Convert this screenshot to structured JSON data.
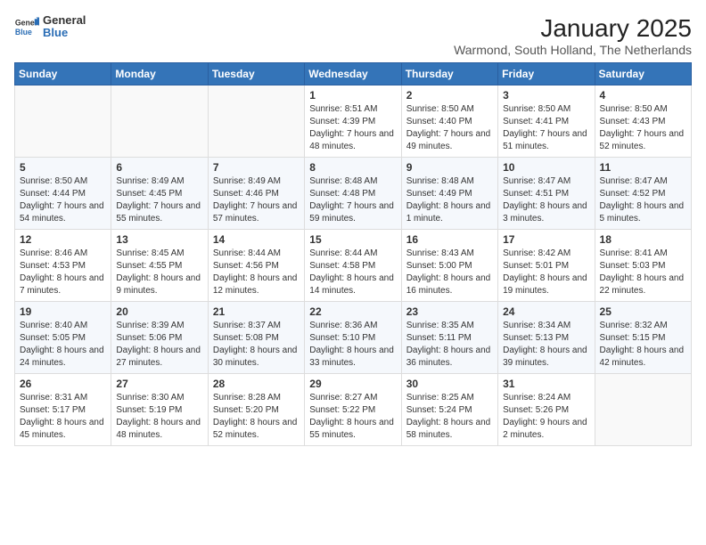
{
  "header": {
    "logo_general": "General",
    "logo_blue": "Blue",
    "title": "January 2025",
    "subtitle": "Warmond, South Holland, The Netherlands"
  },
  "weekdays": [
    "Sunday",
    "Monday",
    "Tuesday",
    "Wednesday",
    "Thursday",
    "Friday",
    "Saturday"
  ],
  "weeks": [
    [
      {
        "day": "",
        "info": ""
      },
      {
        "day": "",
        "info": ""
      },
      {
        "day": "",
        "info": ""
      },
      {
        "day": "1",
        "info": "Sunrise: 8:51 AM\nSunset: 4:39 PM\nDaylight: 7 hours and 48 minutes."
      },
      {
        "day": "2",
        "info": "Sunrise: 8:50 AM\nSunset: 4:40 PM\nDaylight: 7 hours and 49 minutes."
      },
      {
        "day": "3",
        "info": "Sunrise: 8:50 AM\nSunset: 4:41 PM\nDaylight: 7 hours and 51 minutes."
      },
      {
        "day": "4",
        "info": "Sunrise: 8:50 AM\nSunset: 4:43 PM\nDaylight: 7 hours and 52 minutes."
      }
    ],
    [
      {
        "day": "5",
        "info": "Sunrise: 8:50 AM\nSunset: 4:44 PM\nDaylight: 7 hours and 54 minutes."
      },
      {
        "day": "6",
        "info": "Sunrise: 8:49 AM\nSunset: 4:45 PM\nDaylight: 7 hours and 55 minutes."
      },
      {
        "day": "7",
        "info": "Sunrise: 8:49 AM\nSunset: 4:46 PM\nDaylight: 7 hours and 57 minutes."
      },
      {
        "day": "8",
        "info": "Sunrise: 8:48 AM\nSunset: 4:48 PM\nDaylight: 7 hours and 59 minutes."
      },
      {
        "day": "9",
        "info": "Sunrise: 8:48 AM\nSunset: 4:49 PM\nDaylight: 8 hours and 1 minute."
      },
      {
        "day": "10",
        "info": "Sunrise: 8:47 AM\nSunset: 4:51 PM\nDaylight: 8 hours and 3 minutes."
      },
      {
        "day": "11",
        "info": "Sunrise: 8:47 AM\nSunset: 4:52 PM\nDaylight: 8 hours and 5 minutes."
      }
    ],
    [
      {
        "day": "12",
        "info": "Sunrise: 8:46 AM\nSunset: 4:53 PM\nDaylight: 8 hours and 7 minutes."
      },
      {
        "day": "13",
        "info": "Sunrise: 8:45 AM\nSunset: 4:55 PM\nDaylight: 8 hours and 9 minutes."
      },
      {
        "day": "14",
        "info": "Sunrise: 8:44 AM\nSunset: 4:56 PM\nDaylight: 8 hours and 12 minutes."
      },
      {
        "day": "15",
        "info": "Sunrise: 8:44 AM\nSunset: 4:58 PM\nDaylight: 8 hours and 14 minutes."
      },
      {
        "day": "16",
        "info": "Sunrise: 8:43 AM\nSunset: 5:00 PM\nDaylight: 8 hours and 16 minutes."
      },
      {
        "day": "17",
        "info": "Sunrise: 8:42 AM\nSunset: 5:01 PM\nDaylight: 8 hours and 19 minutes."
      },
      {
        "day": "18",
        "info": "Sunrise: 8:41 AM\nSunset: 5:03 PM\nDaylight: 8 hours and 22 minutes."
      }
    ],
    [
      {
        "day": "19",
        "info": "Sunrise: 8:40 AM\nSunset: 5:05 PM\nDaylight: 8 hours and 24 minutes."
      },
      {
        "day": "20",
        "info": "Sunrise: 8:39 AM\nSunset: 5:06 PM\nDaylight: 8 hours and 27 minutes."
      },
      {
        "day": "21",
        "info": "Sunrise: 8:37 AM\nSunset: 5:08 PM\nDaylight: 8 hours and 30 minutes."
      },
      {
        "day": "22",
        "info": "Sunrise: 8:36 AM\nSunset: 5:10 PM\nDaylight: 8 hours and 33 minutes."
      },
      {
        "day": "23",
        "info": "Sunrise: 8:35 AM\nSunset: 5:11 PM\nDaylight: 8 hours and 36 minutes."
      },
      {
        "day": "24",
        "info": "Sunrise: 8:34 AM\nSunset: 5:13 PM\nDaylight: 8 hours and 39 minutes."
      },
      {
        "day": "25",
        "info": "Sunrise: 8:32 AM\nSunset: 5:15 PM\nDaylight: 8 hours and 42 minutes."
      }
    ],
    [
      {
        "day": "26",
        "info": "Sunrise: 8:31 AM\nSunset: 5:17 PM\nDaylight: 8 hours and 45 minutes."
      },
      {
        "day": "27",
        "info": "Sunrise: 8:30 AM\nSunset: 5:19 PM\nDaylight: 8 hours and 48 minutes."
      },
      {
        "day": "28",
        "info": "Sunrise: 8:28 AM\nSunset: 5:20 PM\nDaylight: 8 hours and 52 minutes."
      },
      {
        "day": "29",
        "info": "Sunrise: 8:27 AM\nSunset: 5:22 PM\nDaylight: 8 hours and 55 minutes."
      },
      {
        "day": "30",
        "info": "Sunrise: 8:25 AM\nSunset: 5:24 PM\nDaylight: 8 hours and 58 minutes."
      },
      {
        "day": "31",
        "info": "Sunrise: 8:24 AM\nSunset: 5:26 PM\nDaylight: 9 hours and 2 minutes."
      },
      {
        "day": "",
        "info": ""
      }
    ]
  ]
}
